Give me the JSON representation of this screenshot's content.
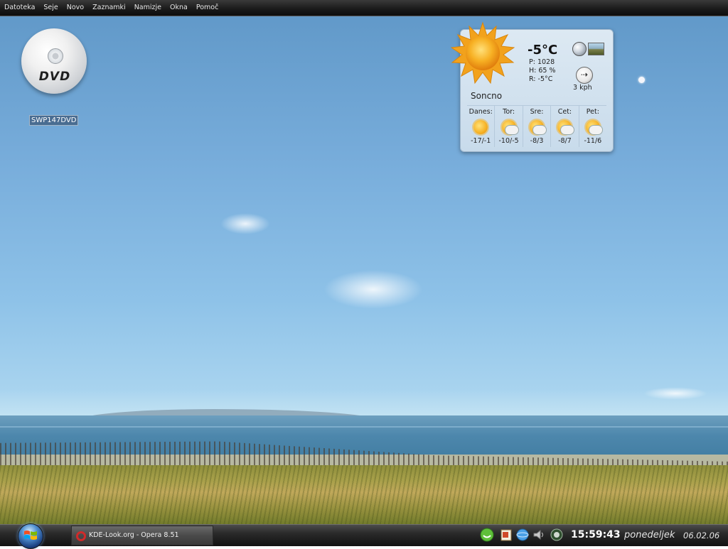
{
  "menubar": {
    "items": [
      "Datoteka",
      "Seje",
      "Novo",
      "Zaznamki",
      "Namizje",
      "Okna",
      "Pomoč"
    ]
  },
  "desktop": {
    "icons": [
      {
        "label": "SWP147DVD",
        "icon": "dvd-icon",
        "disc_text": "DVD"
      }
    ]
  },
  "weather": {
    "current_temp": "-5°C",
    "pressure": "P: 1028",
    "humidity": "H: 65 %",
    "feels_like": "R: -5°C",
    "wind_speed": "3 kph",
    "condition": "Soncno",
    "forecast": [
      {
        "day": "Danes:",
        "temps": "-17/-1",
        "icon": "sun-icon"
      },
      {
        "day": "Tor:",
        "temps": "-10/-5",
        "icon": "partly-cloudy-icon"
      },
      {
        "day": "Sre:",
        "temps": "-8/3",
        "icon": "partly-cloudy-icon"
      },
      {
        "day": "Cet:",
        "temps": "-8/7",
        "icon": "partly-cloudy-icon"
      },
      {
        "day": "Pet:",
        "temps": "-11/6",
        "icon": "partly-cloudy-icon"
      }
    ]
  },
  "taskbar": {
    "window_title": "KDE-Look.org - Opera 8.51",
    "clock": "15:59:43",
    "day_name": "ponedeljek",
    "date": "06.02.06",
    "tray_icons": [
      "network-icon",
      "clipboard-icon",
      "globe-icon",
      "volume-icon",
      "update-icon"
    ]
  },
  "colors": {
    "sky": "#78addb",
    "taskbar": "#1b1b1b",
    "widget_bg": "#d3e3f0",
    "sun": "#f6b124"
  }
}
